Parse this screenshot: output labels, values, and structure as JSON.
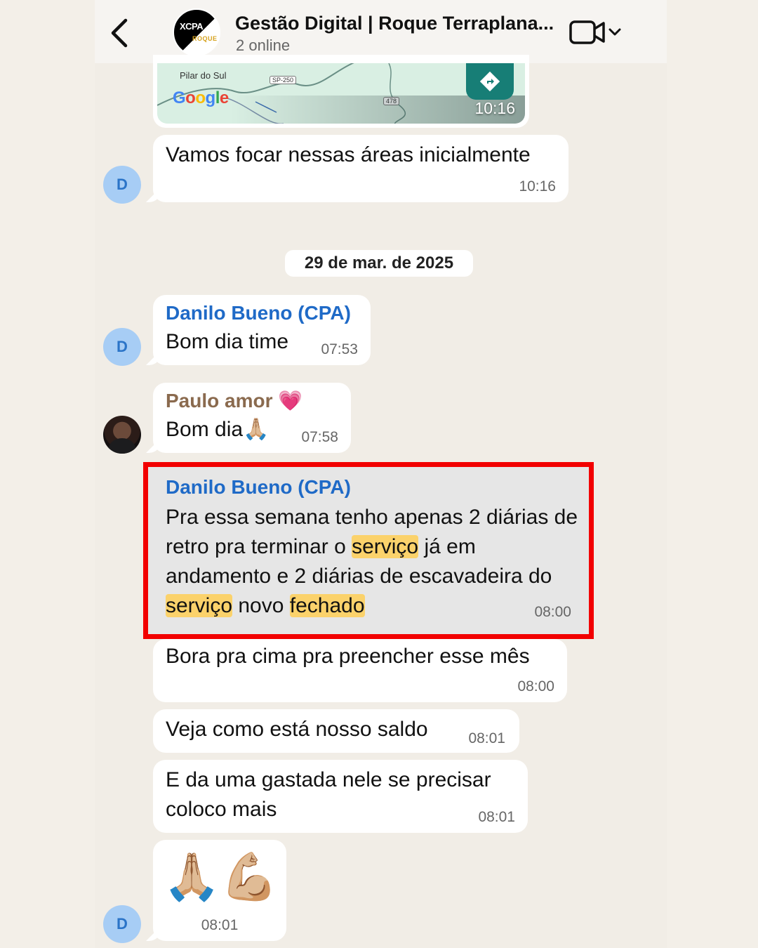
{
  "header": {
    "title": "Gestão Digital | Roque Terraplana...",
    "subtitle": "2 online",
    "avatar_line1": "XCPA",
    "avatar_line2": "ROQUE"
  },
  "map": {
    "labels": [
      "Pilar do Sul",
      "SP-250",
      "478"
    ],
    "google": "Google",
    "time": "10:16"
  },
  "messages": [
    {
      "text": "Vamos focar nessas áreas inicialmente",
      "time": "10:16",
      "avatar": "D"
    },
    {
      "sender": "Danilo Bueno (CPA)",
      "text": "Bom dia time",
      "time": "07:53",
      "avatar": "D"
    },
    {
      "sender": "Paulo amor 💗",
      "text": "Bom dia🙏🏼",
      "time": "07:58"
    },
    {
      "sender": "Danilo Bueno (CPA)",
      "parts": [
        "Pra essa semana tenho apenas 2 diárias de retro pra terminar o ",
        "serviço",
        " já em andamento e 2 diárias de escavadeira do ",
        "serviço",
        " novo ",
        "fechado"
      ],
      "time": "08:00"
    },
    {
      "text": "Bora pra cima pra preencher esse mês",
      "time": "08:00"
    },
    {
      "text": "Veja como está nosso saldo",
      "time": "08:01"
    },
    {
      "text": "E da uma gastada nele se precisar coloco mais",
      "time": "08:01"
    },
    {
      "text": "🙏🏼💪🏼",
      "time": "08:01",
      "avatar": "D"
    }
  ],
  "date_separator": "29 de mar. de 2025",
  "colors": {
    "background": "#f3efe8",
    "sender_blue": "#1f6ac7",
    "sender_brown": "#8a6a4e",
    "highlight_border": "#f20000",
    "keyword_highlight": "#fbd26b"
  }
}
